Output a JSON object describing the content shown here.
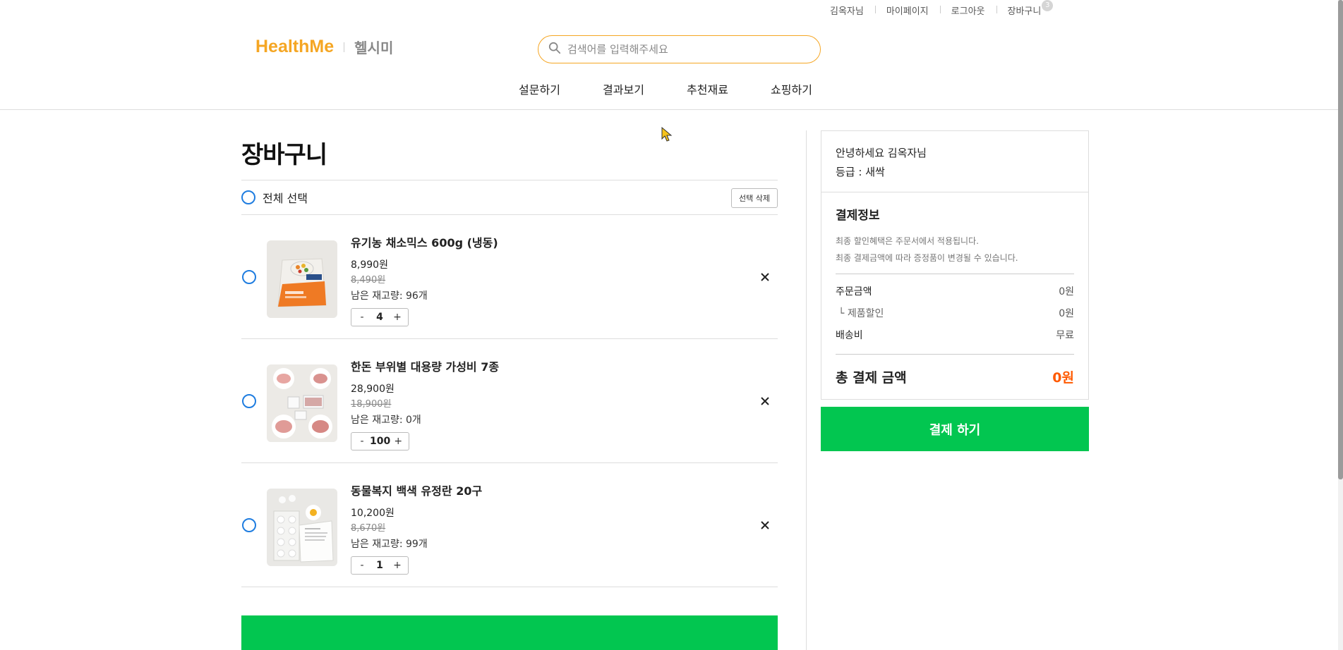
{
  "util": {
    "user": "김옥자님",
    "mypage": "마이페이지",
    "logout": "로그아웃",
    "cart": "장바구니",
    "cart_count": "3"
  },
  "header": {
    "logo_en": "HealthMe",
    "logo_ko": "헬시미",
    "search_placeholder": "검색어를 입력해주세요",
    "nav": [
      "설문하기",
      "결과보기",
      "추천재료",
      "쇼핑하기"
    ]
  },
  "cart": {
    "title": "장바구니",
    "select_all": "전체 선택",
    "delete_selected": "선택 삭제",
    "items": [
      {
        "name": "유기농 채소믹스 600g (냉동)",
        "price": "8,990원",
        "original_price": "8,490원",
        "stock": "남은 재고량: 96개",
        "qty": "4"
      },
      {
        "name": "한돈 부위별 대용량 가성비 7종",
        "price": "28,900원",
        "original_price": "18,900원",
        "stock": "남은 재고량: 0개",
        "qty": "100"
      },
      {
        "name": "동물복지 백색 유정란 20구",
        "price": "10,200원",
        "original_price": "8,670원",
        "stock": "남은 재고량: 99개",
        "qty": "1"
      }
    ]
  },
  "panel": {
    "greeting": "안녕하세요 김옥자님",
    "grade": "등급 : 새싹",
    "pay_title": "결제정보",
    "note1": "최종 할인혜택은 주문서에서 적용됩니다.",
    "note2": "최종 결제금액에 따라 증정품이 변경될 수 있습니다.",
    "order_amount_label": "주문금액",
    "order_amount": "0원",
    "discount_label": "└ 제품할인",
    "discount": "0원",
    "shipping_label": "배송비",
    "shipping": "무료",
    "total_label": "총 결제 금액",
    "total": "0원",
    "pay_button": "결제 하기"
  },
  "colors": {
    "brand_orange": "#f5a623",
    "green": "#02c650",
    "radio_blue": "#1f7de0",
    "total_orange": "#ff5a00"
  }
}
